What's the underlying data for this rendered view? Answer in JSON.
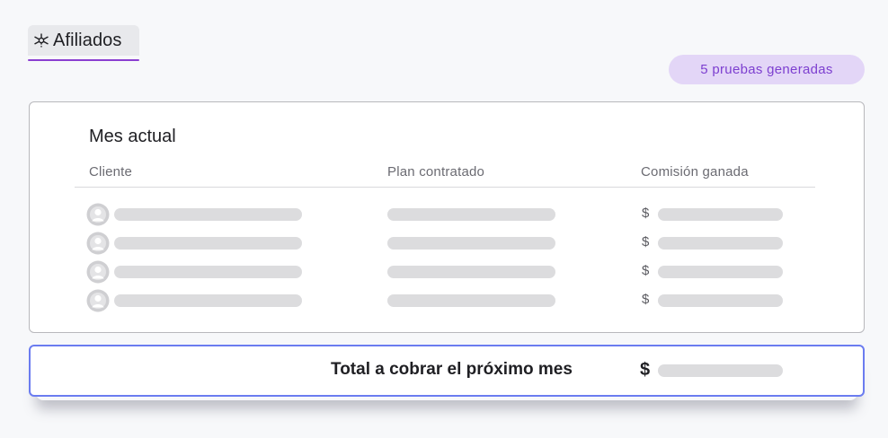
{
  "header": {
    "tab_label": "Afiliados",
    "tab_icon": "network-icon",
    "accent_color": "#8b3fd1"
  },
  "badge": {
    "text": "5 pruebas generadas",
    "color": "#7d3fd0",
    "background": "#e3d6f7"
  },
  "card": {
    "title": "Mes actual",
    "columns": [
      "Cliente",
      "Plan contratado",
      "Comisión ganada"
    ],
    "rows": [
      {
        "currency": "$"
      },
      {
        "currency": "$"
      },
      {
        "currency": "$"
      },
      {
        "currency": "$"
      }
    ]
  },
  "total": {
    "label": "Total a cobrar el próximo mes",
    "currency": "$",
    "border_color": "#6b7cf0"
  }
}
